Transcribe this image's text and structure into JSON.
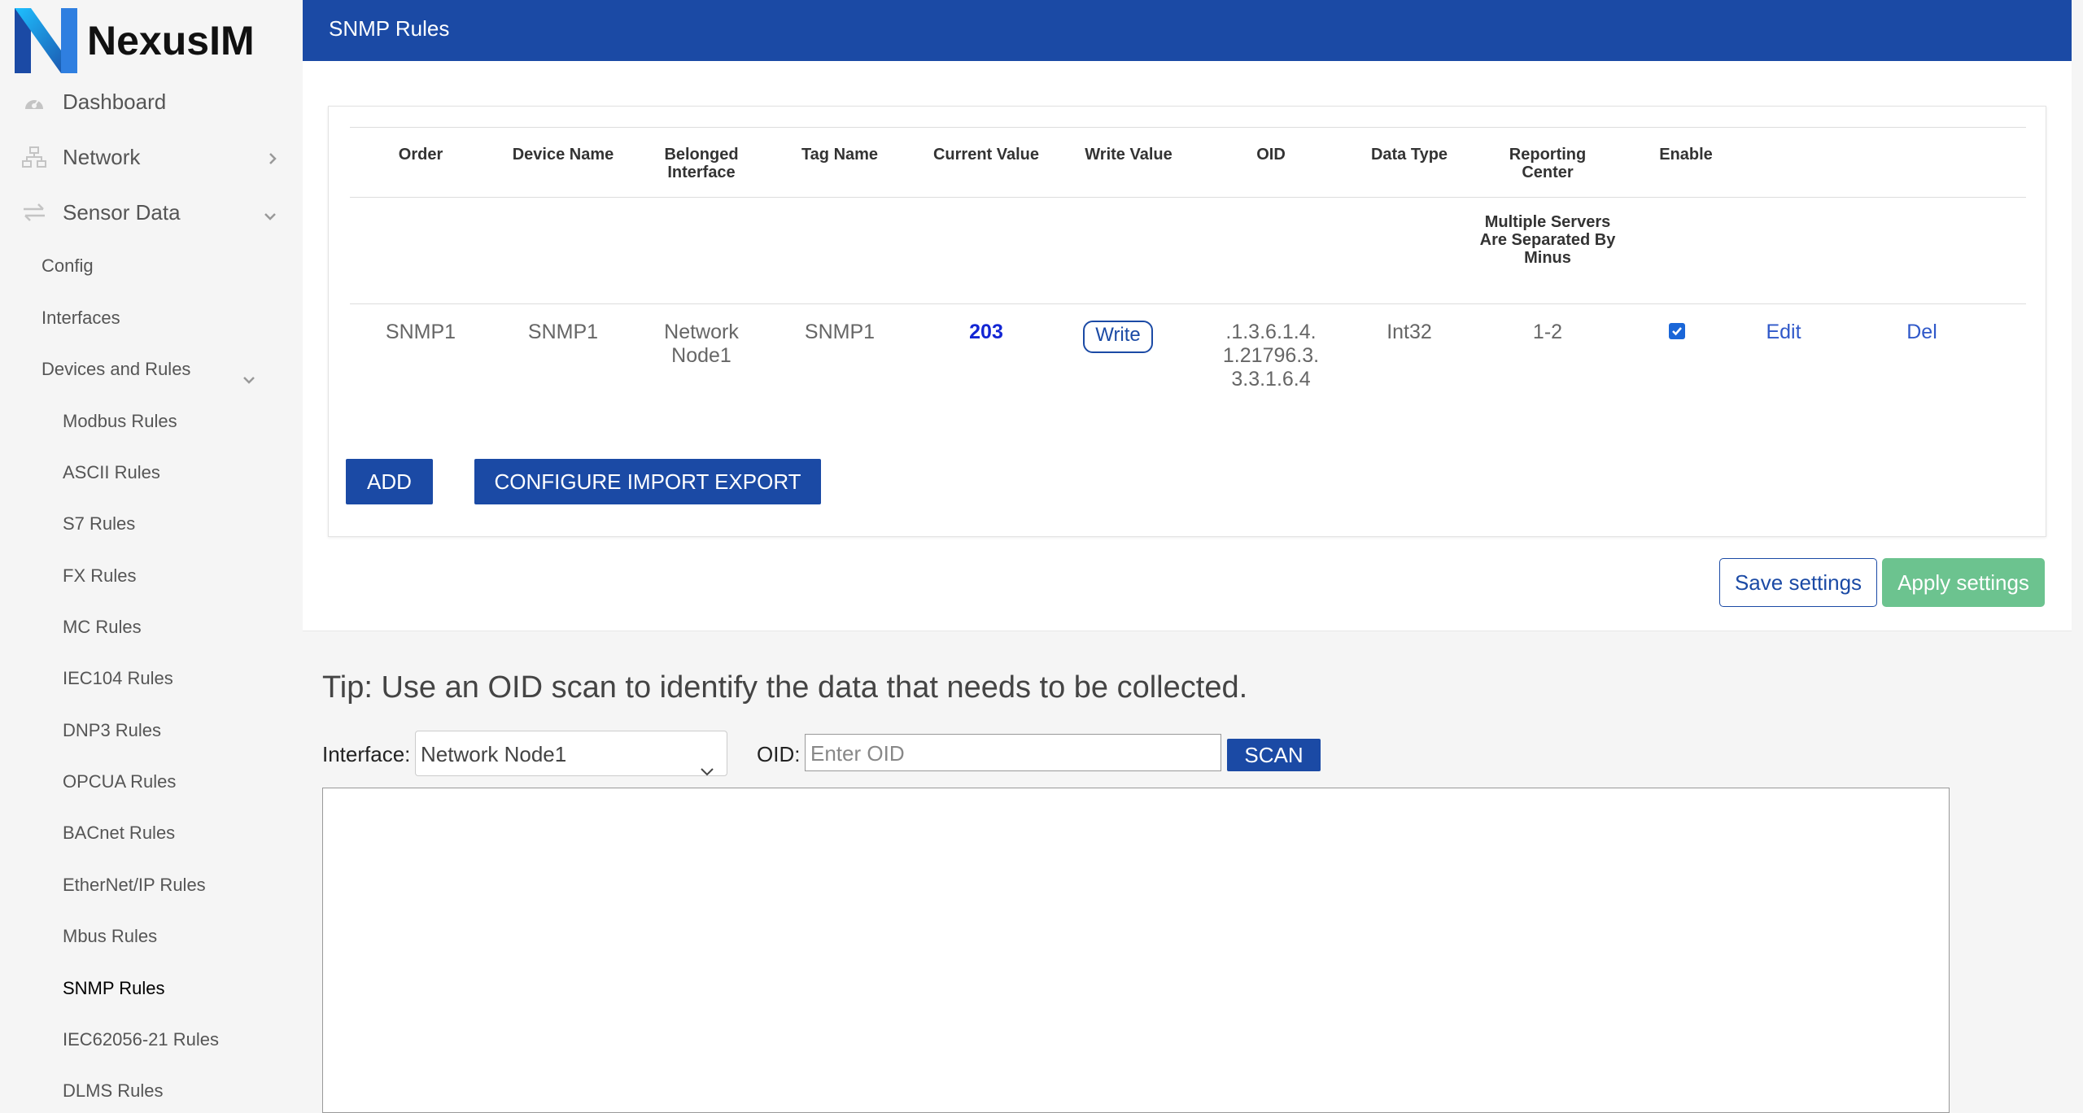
{
  "brand": {
    "name": "NexusIM",
    "accent": "#1b4aa5",
    "logo_gradient": [
      "#1ec0ff",
      "#1b4aa5"
    ]
  },
  "sidebar": {
    "top": [
      {
        "label": "Dashboard",
        "icon": "dashboard-icon"
      },
      {
        "label": "Network",
        "icon": "network-icon",
        "chevron": "right"
      },
      {
        "label": "Sensor Data",
        "icon": "swap-arrows-icon",
        "chevron": "down"
      }
    ],
    "sub": [
      "Config",
      "Interfaces",
      "Devices and Rules"
    ],
    "rules": [
      "Modbus Rules",
      "ASCII Rules",
      "S7 Rules",
      "FX Rules",
      "MC Rules",
      "IEC104 Rules",
      "DNP3 Rules",
      "OPCUA Rules",
      "BACnet Rules",
      "EtherNet/IP Rules",
      "Mbus Rules",
      "SNMP Rules",
      "IEC62056-21 Rules",
      "DLMS Rules"
    ],
    "active_rule": "SNMP Rules"
  },
  "header": {
    "title": "SNMP Rules"
  },
  "table": {
    "headers": {
      "order": "Order",
      "device_name": "Device Name",
      "belonged_interface": "Belonged Interface",
      "tag_name": "Tag Name",
      "current_value": "Current Value",
      "write_value": "Write Value",
      "oid": "OID",
      "data_type": "Data Type",
      "reporting_center": "Reporting Center",
      "enable": "Enable"
    },
    "note": "Multiple Servers Are Separated By Minus",
    "row": {
      "order": "SNMP1",
      "device_name": "SNMP1",
      "interface": "Network Node1",
      "tag_name": "SNMP1",
      "current_value": "203",
      "write_label": "Write",
      "oid": ".1.3.6.1.4.1.21796.3.3.3.1.6.4",
      "data_type": "Int32",
      "reporting_center": "1-2",
      "enabled": true,
      "edit": "Edit",
      "del": "Del"
    }
  },
  "actions": {
    "add": "ADD",
    "configure": "CONFIGURE IMPORT EXPORT",
    "save": "Save settings",
    "apply": "Apply settings",
    "apply_color": "#6cc38f"
  },
  "scan": {
    "tip": "Tip: Use an OID scan to identify the data that needs to be collected.",
    "interface_label": "Interface:",
    "interface_value": "Network Node1",
    "oid_label": "OID:",
    "oid_placeholder": "Enter OID",
    "scan_button": "SCAN"
  }
}
